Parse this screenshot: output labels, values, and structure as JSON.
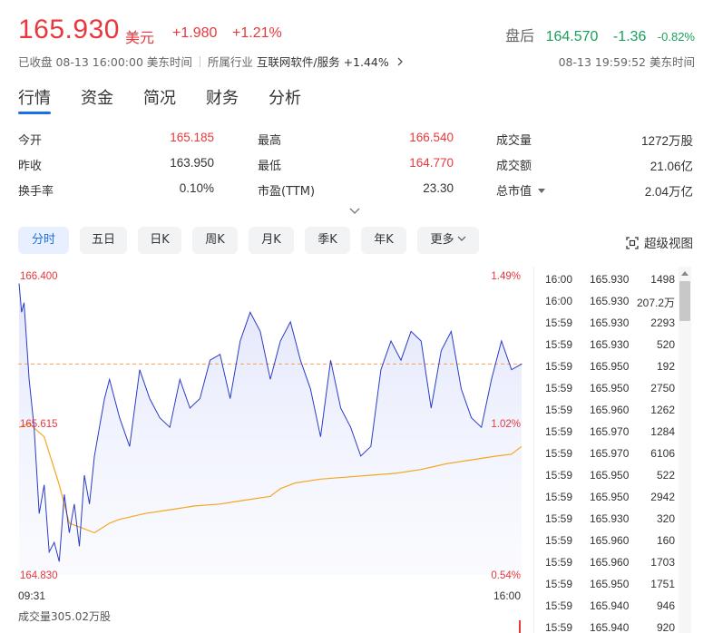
{
  "header": {
    "price": "165.930",
    "currency": "美元",
    "change": "+1.980",
    "change_pct": "+1.21%",
    "after_hours_label": "盘后",
    "after_hours_price": "164.570",
    "after_hours_change": "-1.36",
    "after_hours_pct": "-0.82%"
  },
  "status": {
    "closed": "已收盘 08-13 16:00:00 美东时间",
    "industry_label": "所属行业",
    "industry": "互联网软件/服务 +1.44%",
    "industry_chevron_icon": "chevron-right-icon",
    "time": "08-13 19:59:52 美东时间"
  },
  "tabs": [
    "行情",
    "资金",
    "简况",
    "财务",
    "分析"
  ],
  "stats": [
    [
      {
        "k": "今开",
        "v": "165.185",
        "c": "red"
      },
      {
        "k": "最高",
        "v": "166.540",
        "c": "red"
      },
      {
        "k": "成交量",
        "v": "1272万股",
        "c": "grey"
      }
    ],
    [
      {
        "k": "昨收",
        "v": "163.950",
        "c": "grey"
      },
      {
        "k": "最低",
        "v": "164.770",
        "c": "red"
      },
      {
        "k": "成交额",
        "v": "21.06亿",
        "c": "grey"
      }
    ],
    [
      {
        "k": "换手率",
        "v": "0.10%",
        "c": "grey"
      },
      {
        "k": "市盈(TTM)",
        "v": "23.30",
        "c": "grey"
      },
      {
        "k": "总市值",
        "v": "2.04万亿",
        "c": "grey"
      }
    ]
  ],
  "periods": [
    "分时",
    "五日",
    "日K",
    "周K",
    "月K",
    "季K",
    "年K",
    "更多"
  ],
  "super_view": "超级视图",
  "colors": {
    "up": "#e8383d",
    "down": "#1a9e5a",
    "accent": "#1c6fe8",
    "avg_line": "#f5a623",
    "price_line": "#2a3cc7"
  },
  "chart": {
    "y_top": "166.400",
    "y_mid": "165.615",
    "y_bot": "164.830",
    "pct_top": "1.49%",
    "pct_mid": "1.02%",
    "pct_bot": "0.54%",
    "t_start": "09:31",
    "t_end": "16:00",
    "volume": "成交量305.02万股"
  },
  "chart_data": {
    "type": "line",
    "ylim": [
      164.83,
      166.4
    ],
    "prev_close": 163.95,
    "x_range": [
      "09:31",
      "16:00"
    ],
    "reference_line": 165.93,
    "series": [
      {
        "x": [
          0,
          0.005,
          0.01,
          0.02,
          0.03,
          0.04,
          0.05,
          0.06,
          0.07,
          0.08,
          0.09,
          0.1,
          0.11,
          0.12,
          0.13,
          0.14,
          0.15,
          0.16,
          0.17,
          0.18,
          0.2,
          0.22,
          0.24,
          0.26,
          0.28,
          0.3,
          0.32,
          0.34,
          0.36,
          0.38,
          0.4,
          0.42,
          0.44,
          0.46,
          0.48,
          0.5,
          0.52,
          0.54,
          0.56,
          0.58,
          0.6,
          0.62,
          0.64,
          0.66,
          0.68,
          0.7,
          0.72,
          0.74,
          0.76,
          0.78,
          0.8,
          0.82,
          0.84,
          0.86,
          0.88,
          0.9,
          0.92,
          0.94,
          0.96,
          0.98,
          1
        ],
        "y": [
          166.35,
          166.2,
          166.25,
          165.85,
          165.6,
          165.15,
          165.3,
          164.95,
          165.0,
          164.9,
          165.25,
          165.05,
          165.2,
          164.98,
          165.35,
          165.2,
          165.45,
          165.6,
          165.75,
          165.85,
          165.65,
          165.5,
          165.9,
          165.75,
          165.65,
          165.6,
          165.85,
          165.7,
          165.75,
          165.95,
          165.98,
          165.75,
          166.05,
          166.2,
          166.1,
          165.85,
          166.05,
          166.15,
          165.95,
          165.8,
          165.55,
          165.95,
          165.7,
          165.6,
          165.45,
          165.5,
          165.9,
          166.05,
          165.95,
          166.1,
          166.05,
          165.7,
          166.0,
          166.1,
          165.8,
          165.65,
          165.6,
          165.85,
          166.05,
          165.9,
          165.93
        ]
      },
      {
        "x": [
          0,
          0.02,
          0.05,
          0.08,
          0.1,
          0.12,
          0.15,
          0.18,
          0.2,
          0.25,
          0.3,
          0.35,
          0.4,
          0.45,
          0.5,
          0.52,
          0.55,
          0.6,
          0.65,
          0.7,
          0.75,
          0.8,
          0.85,
          0.9,
          0.95,
          0.98,
          1
        ],
        "y": [
          165.6,
          165.62,
          165.55,
          165.3,
          165.1,
          165.08,
          165.05,
          165.1,
          165.12,
          165.15,
          165.17,
          165.19,
          165.2,
          165.22,
          165.24,
          165.28,
          165.31,
          165.33,
          165.34,
          165.35,
          165.36,
          165.38,
          165.41,
          165.43,
          165.45,
          165.46,
          165.5
        ]
      }
    ]
  },
  "trades": [
    {
      "t": "16:00",
      "p": "165.930",
      "v": "1498"
    },
    {
      "t": "16:00",
      "p": "165.930",
      "v": "207.2万"
    },
    {
      "t": "15:59",
      "p": "165.930",
      "v": "2293"
    },
    {
      "t": "15:59",
      "p": "165.930",
      "v": "520"
    },
    {
      "t": "15:59",
      "p": "165.950",
      "v": "192"
    },
    {
      "t": "15:59",
      "p": "165.950",
      "v": "2750"
    },
    {
      "t": "15:59",
      "p": "165.960",
      "v": "1262"
    },
    {
      "t": "15:59",
      "p": "165.970",
      "v": "1284"
    },
    {
      "t": "15:59",
      "p": "165.970",
      "v": "6106"
    },
    {
      "t": "15:59",
      "p": "165.950",
      "v": "522"
    },
    {
      "t": "15:59",
      "p": "165.950",
      "v": "2942"
    },
    {
      "t": "15:59",
      "p": "165.930",
      "v": "320"
    },
    {
      "t": "15:59",
      "p": "165.960",
      "v": "160"
    },
    {
      "t": "15:59",
      "p": "165.960",
      "v": "1703"
    },
    {
      "t": "15:59",
      "p": "165.950",
      "v": "1751"
    },
    {
      "t": "15:59",
      "p": "165.940",
      "v": "946"
    },
    {
      "t": "15:59",
      "p": "165.940",
      "v": "920"
    }
  ]
}
